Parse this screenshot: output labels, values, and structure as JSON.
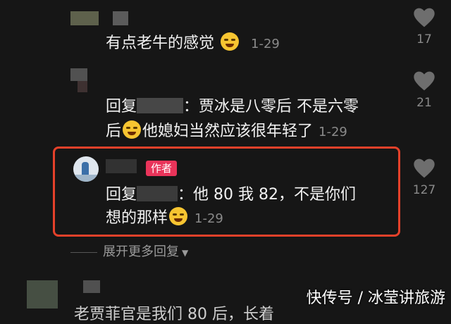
{
  "comments": [
    {
      "text": "有点老牛的感觉",
      "date": "1-29",
      "likes": "17"
    },
    {
      "reply_prefix": "回复",
      "colon": "：",
      "text_line1": "贾冰是八零后 不是六零",
      "text_line2a": "后",
      "text_line2b": "他媳妇当然应该很年轻了",
      "date": "1-29",
      "likes": "21"
    },
    {
      "badge": "作者",
      "reply_prefix": "回复",
      "colon": "：",
      "text_line1": "他 80 我 82，不是你们",
      "text_line2": "想的那样",
      "date": "1-29",
      "likes": "127"
    }
  ],
  "expand_label": "展开更多回复",
  "bottom_partial": "老贾菲官是我们 80 后，长着",
  "watermark": "快传号 / 冰莹讲旅游",
  "colors": {
    "highlight_border": "#e5412a",
    "badge_bg": "#e9345a"
  },
  "icons": [
    "heart-icon",
    "laugh-emoji-icon",
    "smirk-emoji-icon",
    "chevron-down-icon"
  ]
}
